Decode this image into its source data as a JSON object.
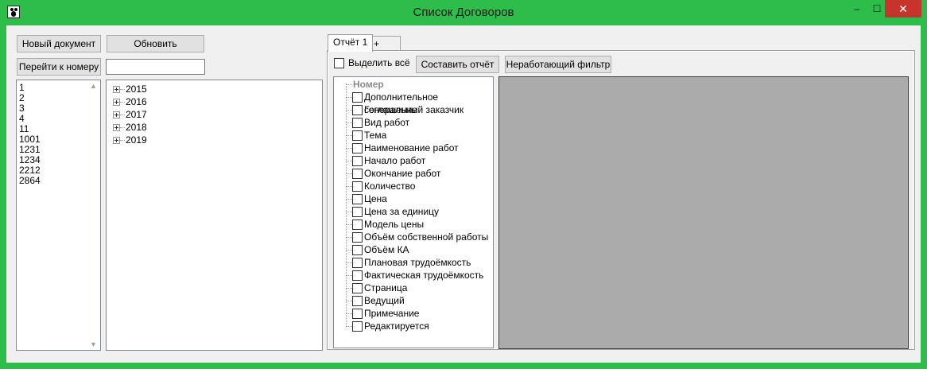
{
  "window": {
    "title": "Список Договоров",
    "controls": {
      "minimize": "–",
      "maximize": "☐",
      "close": "✕"
    }
  },
  "toolbar": {
    "new_document": "Новый документ",
    "refresh": "Обновить",
    "go_to_number": "Перейти к номеру",
    "number_input_value": ""
  },
  "numbers_list": [
    "1",
    "2",
    "3",
    "4",
    "11",
    "1001",
    "1231",
    "1234",
    "2212",
    "2864"
  ],
  "year_tree": [
    "2015",
    "2016",
    "2017",
    "2018",
    "2019"
  ],
  "tabs": [
    {
      "label": "Отчёт 1",
      "active": true
    },
    {
      "label": "+",
      "active": false
    }
  ],
  "report": {
    "select_all": "Выделить всё",
    "make_report": "Составить отчёт",
    "filter": "Неработающий фильтр",
    "root_field": "Номер",
    "fields": [
      "Дополнительное соглашение",
      "Генеральный заказчик",
      "Вид работ",
      "Тема",
      "Наименование работ",
      "Начало работ",
      "Окончание работ",
      "Количество",
      "Цена",
      "Цена за единицу",
      "Модель цены",
      "Объём собственной работы",
      "Объём КА",
      "Плановая трудоёмкость",
      "Фактическая трудоёмкость",
      "Страница",
      "Ведущий",
      "Примечание",
      "Редактируется"
    ]
  },
  "colors": {
    "window_frame": "#2ebd4b",
    "client_bg": "#f0f0f0",
    "grid_bg": "#ababab",
    "close_button": "#c7342c"
  }
}
